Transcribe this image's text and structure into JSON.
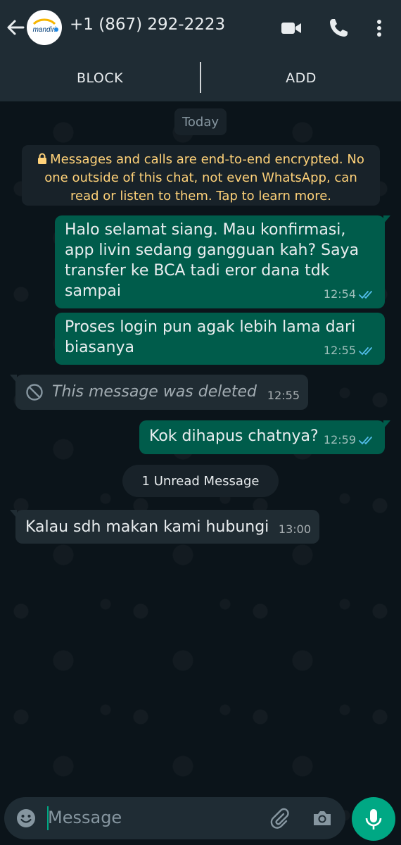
{
  "header": {
    "contact_name": "+1 (867) 292-2223",
    "avatar_text": "mandiri",
    "icons": [
      "back-arrow-icon",
      "video-call-icon",
      "phone-call-icon",
      "more-options-icon"
    ]
  },
  "actions": {
    "block_label": "BLOCK",
    "add_label": "ADD"
  },
  "date_chip": "Today",
  "encryption_notice": "Messages and calls are end-to-end encrypted. No one outside of this chat, not even WhatsApp, can read or listen to them. Tap to learn more.",
  "messages": [
    {
      "direction": "outgoing",
      "text": "Halo selamat siang. Mau konfirmasi, app livin sedang gangguan kah? Saya transfer ke BCA tadi eror dana tdk sampai",
      "time": "12:54",
      "status": "read"
    },
    {
      "direction": "outgoing",
      "text": "Proses login pun agak lebih lama dari biasanya",
      "time": "12:55",
      "status": "read"
    },
    {
      "direction": "incoming",
      "text": "This message was deleted",
      "time": "12:55",
      "deleted": true
    },
    {
      "direction": "outgoing",
      "text": "Kok dihapus chatnya?",
      "time": "12:59",
      "status": "read"
    },
    {
      "direction": "incoming",
      "text": "Kalau sdh makan kami hubungi",
      "time": "13:00"
    }
  ],
  "unread_label": "1 Unread Message",
  "composer": {
    "placeholder": "Message"
  },
  "colors": {
    "header_bg": "#1f2c34",
    "outgoing_bubble": "#005c4b",
    "incoming_bubble": "#202c33",
    "accent": "#00a884",
    "read_tick": "#53bdeb",
    "encryption_text": "#ffd279"
  }
}
